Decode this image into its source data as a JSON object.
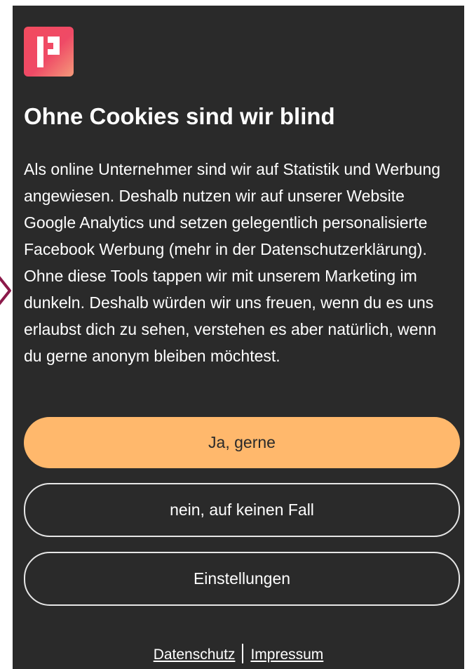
{
  "dialog": {
    "title": "Ohne Cookies sind wir blind",
    "body": "Als online Unternehmer sind wir auf Statistik und Werbung angewiesen. Deshalb nutzen wir auf unserer Website Google Analytics und setzen gelegentlich personalisierte Facebook Werbung (mehr in der Datenschutzerklärung). Ohne diese Tools tappen wir mit unserem Marketing im dunkeln. Deshalb würden wir uns freuen, wenn du es uns erlaubst dich zu sehen, verstehen es aber natürlich, wenn du gerne anonym bleiben möchtest.",
    "buttons": {
      "accept": "Ja, gerne",
      "decline": "nein, auf keinen Fall",
      "settings": "Einstellungen"
    },
    "footer": {
      "privacy": "Datenschutz",
      "imprint": "Impressum"
    }
  },
  "icons": {
    "logo": "brand-logo-icon",
    "chevron": "chevron-right-icon"
  },
  "colors": {
    "background": "#2a2a2a",
    "accent": "#ffb86c",
    "logo_start": "#f24b5e",
    "logo_end": "#f59a7a",
    "chevron": "#8b1a4a"
  }
}
